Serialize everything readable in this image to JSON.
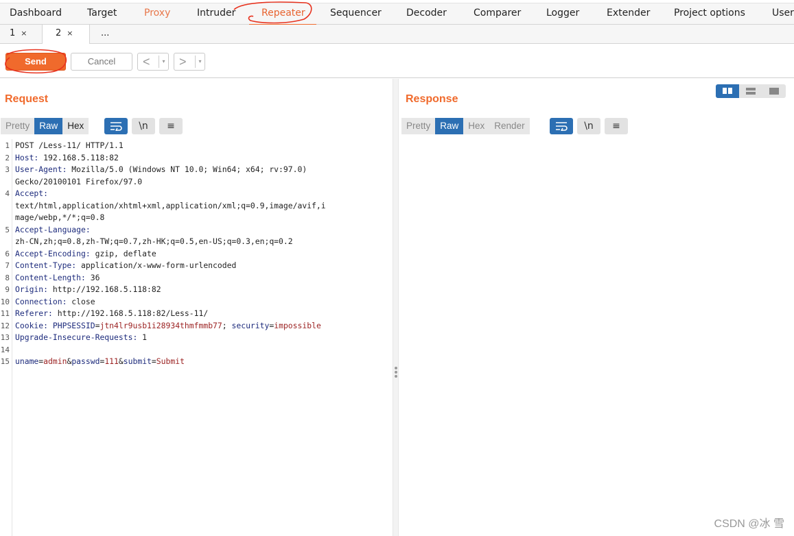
{
  "main_tabs": [
    "Dashboard",
    "Target",
    "Proxy",
    "Intruder",
    "Repeater",
    "Sequencer",
    "Decoder",
    "Comparer",
    "Logger",
    "Extender",
    "Project options",
    "User"
  ],
  "sub_tabs": [
    {
      "label": "1",
      "close": "×"
    },
    {
      "label": "2",
      "close": "×"
    },
    {
      "label": "..."
    }
  ],
  "toolbar": {
    "send": "Send",
    "cancel": "Cancel",
    "back": "<",
    "forward": ">",
    "dropdown": "▾"
  },
  "request": {
    "title": "Request",
    "view_modes": [
      "Pretty",
      "Raw",
      "Hex"
    ],
    "active_mode": "Raw",
    "lines": [
      {
        "n": "1",
        "h": "",
        "v": "POST /Less-11/ HTTP/1.1"
      },
      {
        "n": "2",
        "h": "Host:",
        "v": " 192.168.5.118:82"
      },
      {
        "n": "3",
        "h": "User-Agent:",
        "v": " Mozilla/5.0 (Windows NT 10.0; Win64; x64; rv:97.0)"
      },
      {
        "n": "",
        "h": "",
        "v": "Gecko/20100101 Firefox/97.0"
      },
      {
        "n": "4",
        "h": "Accept:",
        "v": ""
      },
      {
        "n": "",
        "h": "",
        "v": "text/html,application/xhtml+xml,application/xml;q=0.9,image/avif,i"
      },
      {
        "n": "",
        "h": "",
        "v": "mage/webp,*/*;q=0.8"
      },
      {
        "n": "5",
        "h": "Accept-Language:",
        "v": ""
      },
      {
        "n": "",
        "h": "",
        "v": "zh-CN,zh;q=0.8,zh-TW;q=0.7,zh-HK;q=0.5,en-US;q=0.3,en;q=0.2"
      },
      {
        "n": "6",
        "h": "Accept-Encoding:",
        "v": " gzip, deflate"
      },
      {
        "n": "7",
        "h": "Content-Type:",
        "v": " application/x-www-form-urlencoded"
      },
      {
        "n": "8",
        "h": "Content-Length:",
        "v": " 36"
      },
      {
        "n": "9",
        "h": "Origin:",
        "v": " http://192.168.5.118:82"
      },
      {
        "n": "10",
        "h": "Connection:",
        "v": " close"
      },
      {
        "n": "11",
        "h": "Referer:",
        "v": " http://192.168.5.118:82/Less-11/"
      },
      {
        "n": "12",
        "h": "Cookie:",
        "v": ""
      },
      {
        "n": "13",
        "h": "Upgrade-Insecure-Requests:",
        "v": " 1"
      },
      {
        "n": "14",
        "h": "",
        "v": ""
      },
      {
        "n": "15",
        "h": "",
        "v": ""
      }
    ],
    "cookie": [
      {
        "k": "PHPSESSID",
        "v": "jtn4lr9usb1i28934thmfmmb77"
      },
      {
        "k": "security",
        "v": "impossible"
      }
    ],
    "body": [
      {
        "k": "uname",
        "v": "admin"
      },
      {
        "k": "passwd",
        "v": "111"
      },
      {
        "k": "submit",
        "v": "Submit"
      }
    ]
  },
  "response": {
    "title": "Response",
    "view_modes": [
      "Pretty",
      "Raw",
      "Hex",
      "Render"
    ],
    "active_mode": "Raw"
  },
  "icons": {
    "wrap": "wrap-lines-icon",
    "newline": "\\n",
    "menu": "≡"
  },
  "watermark": "CSDN @冰 雪",
  "colors": {
    "accent": "#f06a2c",
    "active_blue": "#2c6fb3",
    "header_name": "#1d2b7c",
    "param_value": "#9a1f1f"
  }
}
